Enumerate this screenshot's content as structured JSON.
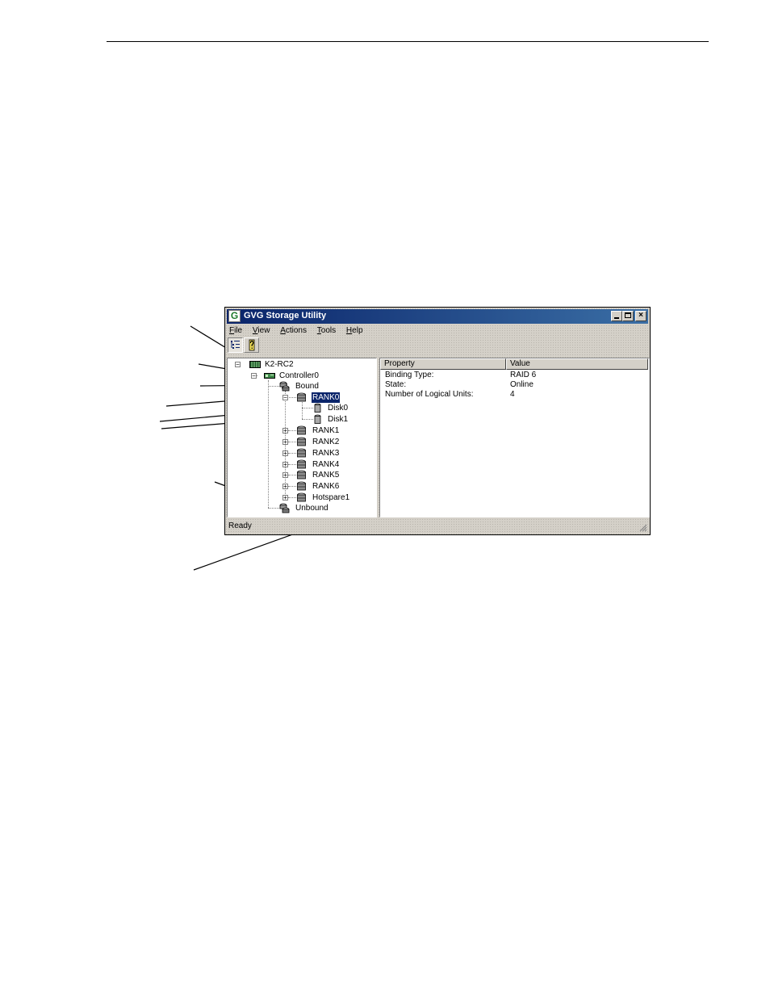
{
  "window": {
    "title": "GVG Storage Utility",
    "app_icon_glyph": "G",
    "caption_buttons": {
      "close": "×"
    }
  },
  "menu": [
    {
      "accel": "F",
      "rest": "ile"
    },
    {
      "accel": "V",
      "rest": "iew"
    },
    {
      "accel": "A",
      "rest": "ctions"
    },
    {
      "accel": "T",
      "rest": "ools"
    },
    {
      "accel": "H",
      "rest": "elp"
    }
  ],
  "toolbar": {
    "tree_view_icon": "tree-view-icon",
    "help_icon": "help-question-icon"
  },
  "tree": {
    "root": "K2-RC2",
    "controller": "Controller0",
    "bound": "Bound",
    "rank0": "RANK0",
    "disk0": "Disk0",
    "disk1": "Disk1",
    "rank1": "RANK1",
    "rank2": "RANK2",
    "rank3": "RANK3",
    "rank4": "RANK4",
    "rank5": "RANK5",
    "rank6": "RANK6",
    "hotspare": "Hotspare1",
    "unbound": "Unbound",
    "collapse_glyph": "−",
    "expand_glyph": "+"
  },
  "properties": {
    "headers": {
      "property": "Property",
      "value": "Value"
    },
    "rows": [
      {
        "name": "Binding Type:",
        "value": "RAID 6"
      },
      {
        "name": "State:",
        "value": "Online"
      },
      {
        "name": "Number of Logical Units:",
        "value": "4"
      }
    ]
  },
  "status": {
    "text": "Ready"
  }
}
